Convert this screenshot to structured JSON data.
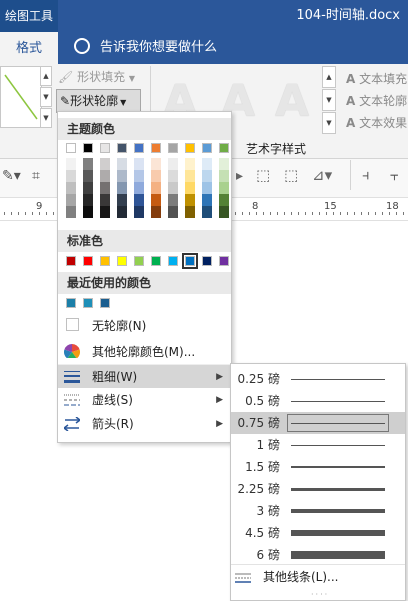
{
  "titlebar": {
    "tools_tab": "绘图工具",
    "doc_title": "104-时间轴.docx"
  },
  "tabs": {
    "format": "格式",
    "tell_me": "告诉我你想要做什么"
  },
  "ribbon": {
    "shape_fill": "形状填充",
    "shape_outline": "形状轮廓",
    "wordart_letters": [
      "A",
      "A",
      "A"
    ],
    "text_fill": "文本填充",
    "text_outline": "文本轮廓",
    "text_effects": "文本效果",
    "wordart_group": "艺术字样式"
  },
  "ruler": {
    "labels": [
      "9",
      "8",
      "15",
      "18"
    ]
  },
  "menu": {
    "theme_colors_label": "主题颜色",
    "standard_colors_label": "标准色",
    "recent_colors_label": "最近使用的颜色",
    "no_outline": "无轮廓(N)",
    "more_colors": "其他轮廓颜色(M)...",
    "weight": "粗细(W)",
    "dashes": "虚线(S)",
    "arrows": "箭头(R)",
    "theme_top": [
      "#ffffff",
      "#000000",
      "#e7e6e6",
      "#44546a",
      "#4472c4",
      "#ed7d31",
      "#a5a5a5",
      "#ffc000",
      "#5b9bd5",
      "#70ad47"
    ],
    "theme_shades": [
      [
        "#f2f2f2",
        "#d9d9d9",
        "#bfbfbf",
        "#a6a6a6",
        "#808080"
      ],
      [
        "#7f7f7f",
        "#595959",
        "#404040",
        "#262626",
        "#0d0d0d"
      ],
      [
        "#d0cece",
        "#aeabab",
        "#757171",
        "#3a3838",
        "#171616"
      ],
      [
        "#d6dce4",
        "#adb9ca",
        "#8497b0",
        "#333f4f",
        "#222a35"
      ],
      [
        "#dae3f3",
        "#b4c7e7",
        "#8faadc",
        "#2f5597",
        "#1f3864"
      ],
      [
        "#fbe5d6",
        "#f8cbad",
        "#f4b183",
        "#c55a11",
        "#843c0c"
      ],
      [
        "#ededed",
        "#dbdbdb",
        "#c9c9c9",
        "#7b7b7b",
        "#525252"
      ],
      [
        "#fff2cc",
        "#ffe699",
        "#ffd966",
        "#bf9000",
        "#7f6000"
      ],
      [
        "#deebf7",
        "#bdd7ee",
        "#9dc3e6",
        "#2e75b6",
        "#1f4e79"
      ],
      [
        "#e2f0d9",
        "#c5e0b4",
        "#a9d18e",
        "#548235",
        "#375623"
      ]
    ],
    "standard": [
      "#c00000",
      "#ff0000",
      "#ffc000",
      "#ffff00",
      "#92d050",
      "#00b050",
      "#00b0f0",
      "#0070c0",
      "#002060",
      "#7030a0"
    ],
    "recent": [
      "#1b7fa8",
      "#1e8fb8",
      "#1b5e8f"
    ]
  },
  "weights": {
    "items": [
      {
        "label": "0.25 磅",
        "thickness": 0.25
      },
      {
        "label": "0.5 磅",
        "thickness": 0.5
      },
      {
        "label": "0.75 磅",
        "thickness": 0.75
      },
      {
        "label": "1 磅",
        "thickness": 1
      },
      {
        "label": "1.5 磅",
        "thickness": 1.5
      },
      {
        "label": "2.25 磅",
        "thickness": 2.25
      },
      {
        "label": "3 磅",
        "thickness": 3
      },
      {
        "label": "4.5 磅",
        "thickness": 4.5
      },
      {
        "label": "6 磅",
        "thickness": 6
      }
    ],
    "selected_index": 2,
    "more_lines": "其他线条(L)..."
  }
}
